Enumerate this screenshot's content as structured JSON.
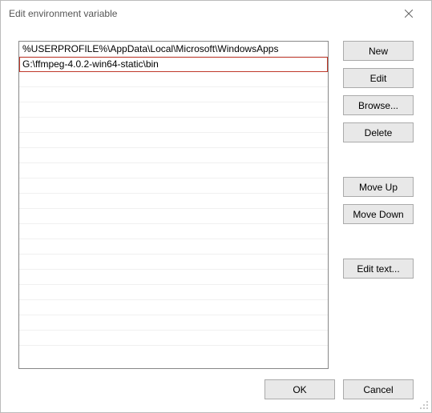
{
  "window": {
    "title": "Edit environment variable"
  },
  "list": {
    "entries": [
      "%USERPROFILE%\\AppData\\Local\\Microsoft\\WindowsApps",
      "G:\\ffmpeg-4.0.2-win64-static\\bin"
    ],
    "highlighted_index": 1
  },
  "buttons": {
    "new": "New",
    "edit": "Edit",
    "browse": "Browse...",
    "delete": "Delete",
    "move_up": "Move Up",
    "move_down": "Move Down",
    "edit_text": "Edit text...",
    "ok": "OK",
    "cancel": "Cancel"
  },
  "list_total_rows": 20
}
